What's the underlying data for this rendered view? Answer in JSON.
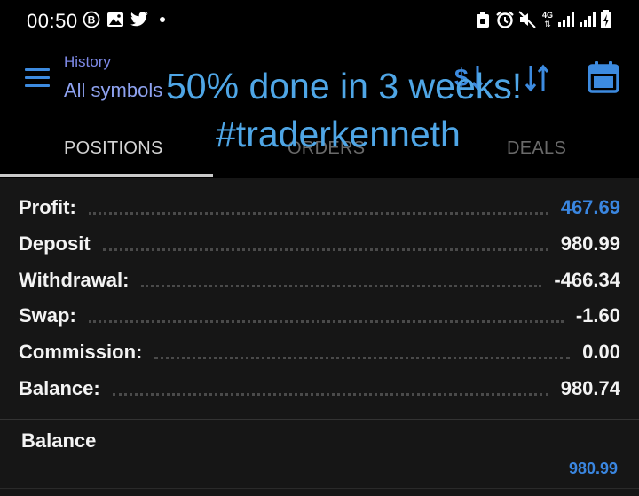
{
  "status_bar": {
    "time": "00:50",
    "left_icons": [
      "b-circle-icon",
      "image-icon",
      "twitter-bird-icon",
      "dot-icon"
    ],
    "network": "4G",
    "right_icons": [
      "lock-icon",
      "alarm-icon",
      "mute-icon",
      "network-4g-icon",
      "signal-icon",
      "signal-icon",
      "battery-icon"
    ]
  },
  "header": {
    "subtitle": "History",
    "title": "All symbols",
    "actions": [
      "dollar-sort-icon",
      "sort-arrows-icon",
      "calendar-icon"
    ]
  },
  "tabs": [
    {
      "label": "POSITIONS",
      "active": true
    },
    {
      "label": "ORDERS",
      "active": false
    },
    {
      "label": "DEALS",
      "active": false
    }
  ],
  "overlay": {
    "line1": "50% done in 3 weeks!",
    "line2": "#traderkenneth"
  },
  "summary": [
    {
      "label": "Profit:",
      "value": "467.69",
      "highlight": true
    },
    {
      "label": "Deposit",
      "value": "980.99",
      "highlight": false
    },
    {
      "label": "Withdrawal:",
      "value": "-466.34",
      "highlight": false
    },
    {
      "label": "Swap:",
      "value": "-1.60",
      "highlight": false
    },
    {
      "label": "Commission:",
      "value": "0.00",
      "highlight": false
    },
    {
      "label": "Balance:",
      "value": "980.74",
      "highlight": false
    }
  ],
  "balance_entry": {
    "title": "Balance",
    "value": "980.99"
  },
  "colors": {
    "accent": "#3d8be0",
    "profit_value": "#3a86e0",
    "overlay_text": "#4fa6e6",
    "header_text": "#8ea2f0",
    "panel_bg": "#161616"
  }
}
